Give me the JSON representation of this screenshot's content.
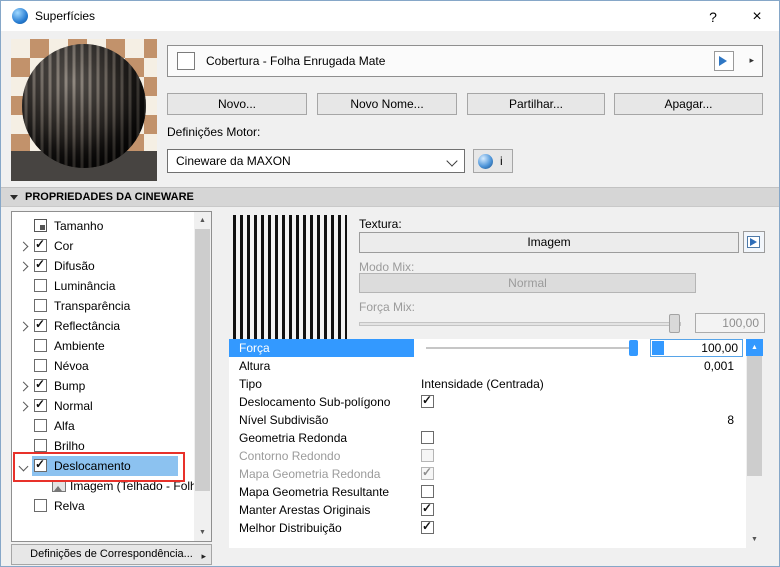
{
  "window": {
    "title": "Superfícies",
    "help": "?",
    "close": "×"
  },
  "colors": {
    "accent": "#3399ff",
    "annotation": "#e8312a"
  },
  "icons": {
    "check": "✓",
    "scroll_up": "▲",
    "scroll_down": "▼",
    "flyout": "▸"
  },
  "material": {
    "name": "Cobertura - Folha Enrugada Mate"
  },
  "actions": {
    "new": "Novo...",
    "rename": "Novo Nome...",
    "share": "Partilhar...",
    "delete": "Apagar..."
  },
  "engine": {
    "label": "Definições Motor:",
    "selected": "Cineware da MAXON",
    "info": "i"
  },
  "section": {
    "title": "PROPRIEDADES DA CINEWARE"
  },
  "tree": {
    "items": [
      {
        "label": "Tamanho"
      },
      {
        "label": "Cor",
        "checked": true
      },
      {
        "label": "Difusão",
        "checked": true
      },
      {
        "label": "Luminância",
        "checked": false
      },
      {
        "label": "Transparência",
        "checked": false
      },
      {
        "label": "Reflectância",
        "checked": true
      },
      {
        "label": "Ambiente",
        "checked": false
      },
      {
        "label": "Névoa",
        "checked": false
      },
      {
        "label": "Bump",
        "checked": true
      },
      {
        "label": "Normal",
        "checked": true
      },
      {
        "label": "Alfa",
        "checked": false
      },
      {
        "label": "Brilho",
        "checked": false
      },
      {
        "label": "Deslocamento",
        "checked": true,
        "selected": true
      },
      {
        "label": "Imagem (Telhado - Folha C"
      },
      {
        "label": "Relva",
        "checked": false
      }
    ]
  },
  "matching_button": "Definições de Correspondência...",
  "texture": {
    "label": "Textura:",
    "image_button": "Imagem",
    "mix_mode_label": "Modo Mix:",
    "mix_mode_value": "Normal",
    "mix_strength_label": "Força Mix:",
    "mix_strength_value": "100,00"
  },
  "properties": [
    {
      "label": "Força",
      "value": "100,00"
    },
    {
      "label": "Altura",
      "value": "0,001"
    },
    {
      "label": "Tipo",
      "value": "Intensidade (Centrada)"
    },
    {
      "label": "Deslocamento Sub-polígono",
      "checked": true
    },
    {
      "label": "Nível Subdivisão",
      "value": "8"
    },
    {
      "label": "Geometria Redonda",
      "checked": false
    },
    {
      "label": "Contorno Redondo",
      "checked": false,
      "disabled": true
    },
    {
      "label": "Mapa Geometria Redonda",
      "checked": true,
      "disabled": true
    },
    {
      "label": "Mapa Geometria Resultante",
      "checked": false
    },
    {
      "label": "Manter Arestas Originais",
      "checked": true
    },
    {
      "label": "Melhor Distribuição",
      "checked": true
    }
  ]
}
